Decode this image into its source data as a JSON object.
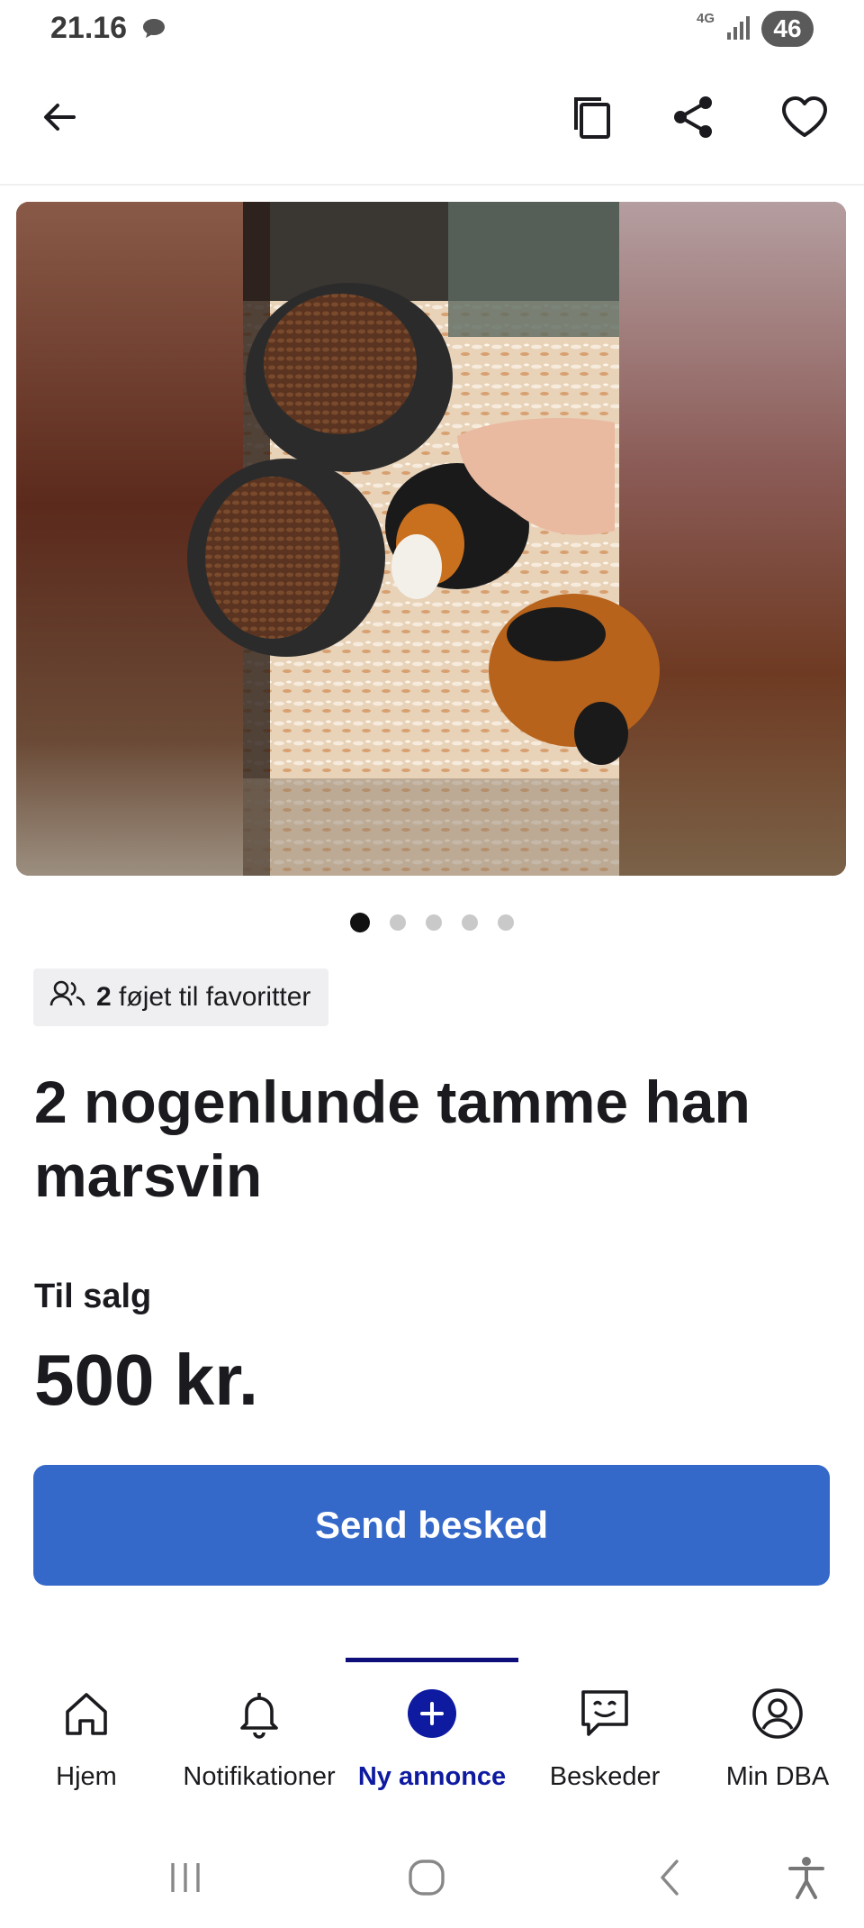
{
  "status_bar": {
    "time": "21.16",
    "network": "4G",
    "battery": "46"
  },
  "listing": {
    "favorites_count": "2",
    "favorites_text": "føjet til favoritter",
    "title": "2 nogenlunde tamme han marsvin",
    "status": "Til salg",
    "price": "500 kr.",
    "image_count": 5,
    "current_image": 1
  },
  "actions": {
    "send_message": "Send besked"
  },
  "bottom_nav": {
    "items": [
      {
        "label": "Hjem",
        "icon": "home-icon"
      },
      {
        "label": "Notifikationer",
        "icon": "bell-icon"
      },
      {
        "label": "Ny annonce",
        "icon": "plus-icon",
        "active": true
      },
      {
        "label": "Beskeder",
        "icon": "message-icon"
      },
      {
        "label": "Min DBA",
        "icon": "profile-icon"
      }
    ]
  },
  "colors": {
    "accent": "#3569c9",
    "nav_active": "#0e1aa0"
  }
}
